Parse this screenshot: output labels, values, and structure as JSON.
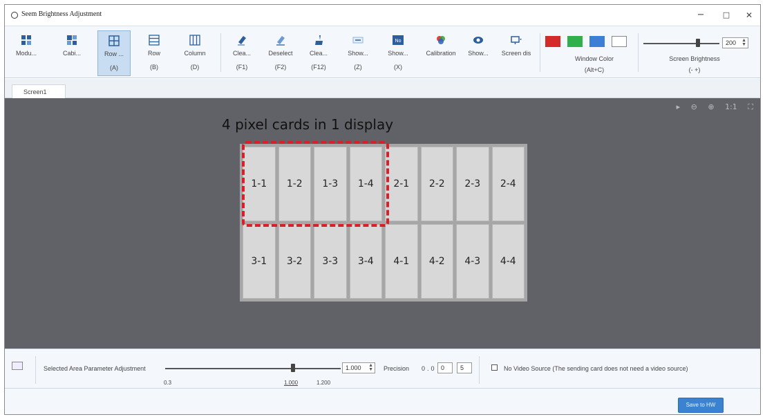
{
  "window": {
    "title": "Seem Brightness Adjustment",
    "controls": {
      "minimize": "−",
      "maximize": "□",
      "close": "✕"
    }
  },
  "toolbar": {
    "tools": [
      {
        "label": "Modu...",
        "key": "",
        "icon": "module-icon"
      },
      {
        "label": "Cabi...",
        "key": "",
        "icon": "cabinet-icon"
      },
      {
        "label": "Row ...",
        "key": "(A)",
        "icon": "row-grid-icon",
        "active": true
      },
      {
        "label": "Row",
        "key": "(B)",
        "icon": "row-icon"
      },
      {
        "label": "Column",
        "key": "(D)",
        "icon": "column-icon"
      },
      {
        "label": "Clea...",
        "key": "(F1)",
        "icon": "eraser-icon"
      },
      {
        "label": "Deselect",
        "key": "(F2)",
        "icon": "deselect-icon"
      },
      {
        "label": "Clea...",
        "key": "(F12)",
        "icon": "broom-icon"
      },
      {
        "label": "Show...",
        "key": "(Z)",
        "icon": "show-icon"
      },
      {
        "label": "Show...",
        "key": "(X)",
        "icon": "no-icon"
      },
      {
        "label": "Calibration",
        "key": "",
        "icon": "calibration-icon"
      },
      {
        "label": "Show...",
        "key": "",
        "icon": "eye-icon"
      },
      {
        "label": "Screen dis",
        "key": "",
        "icon": "screen-display-icon"
      }
    ],
    "window_color": {
      "label": "Window Color",
      "key": "(Alt+C)",
      "swatches": [
        "#d42a2a",
        "#2fb04b",
        "#3d7fd6",
        "#ffffff"
      ]
    },
    "screen_brightness": {
      "label": "Screen Brightness",
      "key": "(-  +)",
      "value": "200"
    }
  },
  "tabs": [
    {
      "label": "Screen1"
    }
  ],
  "canvas": {
    "view_tools": [
      "▸",
      "⊖",
      "⊕",
      "1:1",
      "⛶"
    ],
    "caption": "4 pixel cards in 1 display",
    "cells": [
      "1-1",
      "1-2",
      "1-3",
      "1-4",
      "2-1",
      "2-2",
      "2-3",
      "2-4",
      "3-1",
      "3-2",
      "3-3",
      "3-4",
      "4-1",
      "4-2",
      "4-3",
      "4-4"
    ]
  },
  "adjustment": {
    "label": "Selected Area Parameter Adjustment",
    "min": "0.3",
    "mid": "1.000",
    "max": "1.200",
    "value": "1.000",
    "precision_label": "Precision",
    "precision_static": "0.0",
    "precision_value_1": "0",
    "precision_value_2": "5",
    "no_video_label": "No Video Source (The sending card does not need a video source)",
    "save_button": "Save to HW"
  }
}
